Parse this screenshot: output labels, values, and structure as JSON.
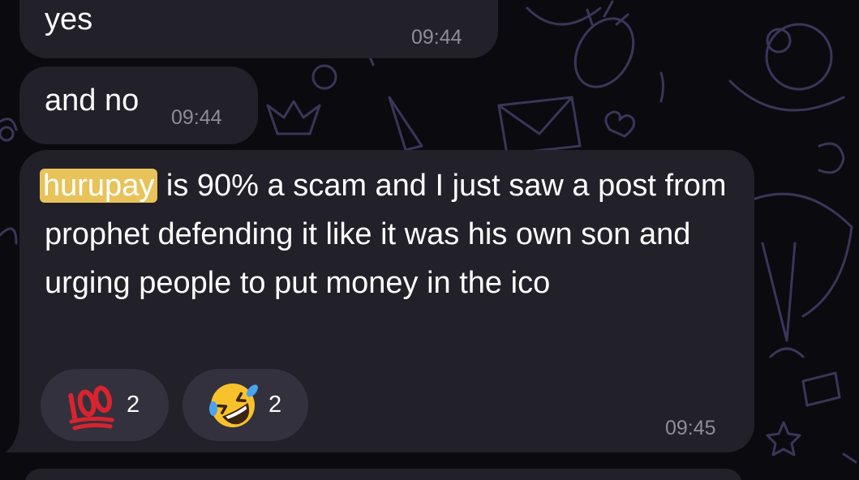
{
  "messages": [
    {
      "text": "yes",
      "time": "09:44"
    },
    {
      "text": "and no",
      "time": "09:44"
    },
    {
      "highlight": "hurupay",
      "rest": " is 90% a scam and I just saw a post from prophet defending it like it was his own son and urging people to put money in the ico",
      "time": "09:45",
      "reactions": [
        {
          "icon": "hundred-points-emoji",
          "count": "2"
        },
        {
          "icon": "rolling-on-floor-laughing-emoji",
          "count": "2"
        }
      ]
    }
  ],
  "colors": {
    "background": "#0b0a0f",
    "bubble": "#222029",
    "highlight": "#e8c35a",
    "timestamp": "#8e8c97",
    "reaction_pill": "#34313e"
  }
}
